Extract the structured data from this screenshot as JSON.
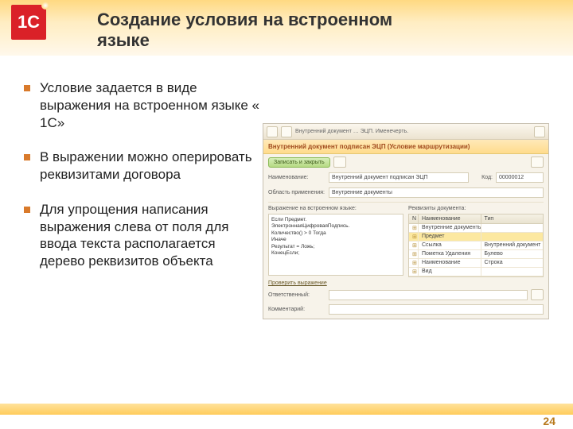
{
  "logo": "1C",
  "title_line1": "Создание условия на встроенном",
  "title_line2": "языке",
  "bullets": [
    "Условие задается в виде выражения на встроенном языке « 1С»",
    "В выражении можно оперировать реквизитами договора",
    "Для упрощения написания выражения слева от поля для ввода текста располагается дерево реквизитов объекта"
  ],
  "shot": {
    "toolbar_text": "Внутренний документ … ЭЦП. Именечерть.",
    "window_title": "Внутренний документ подписан ЭЦП (Условие маршрутизации)",
    "save_close": "Записать и закрыть",
    "labels": {
      "name": "Наименование:",
      "namespace": "Область применения:",
      "code": "Код:",
      "left_head": "Выражение на встроенном языке:",
      "right_head": "Реквизиты документа:",
      "check": "Проверить выражение",
      "resp": "Ответственный:",
      "comment": "Комментарий:"
    },
    "values": {
      "name": "Внутренний документ подписан ЭЦП",
      "namespace": "Внутренние документы",
      "code": "00000012"
    },
    "expression_lines": "Если Предмет.\nЭлектроннаяЦифроваяПодпись.\nКоличество() > 0 Тогда\nИначе\nРезультат = Ложь;\nКонецЕсли;",
    "table": {
      "col_n": "N",
      "col_name": "Наименование",
      "col_type": "Тип",
      "rows": [
        {
          "name": "Внутренние документы",
          "type": ""
        },
        {
          "name": "Предмет",
          "type": "",
          "sel": true
        },
        {
          "name": "Ссылка",
          "type": "Внутренний документ"
        },
        {
          "name": "Пометка Удаления",
          "type": "Булево"
        },
        {
          "name": "Наименование",
          "type": "Строка"
        },
        {
          "name": "Вид",
          "type": ""
        }
      ]
    }
  },
  "page_number": "24"
}
